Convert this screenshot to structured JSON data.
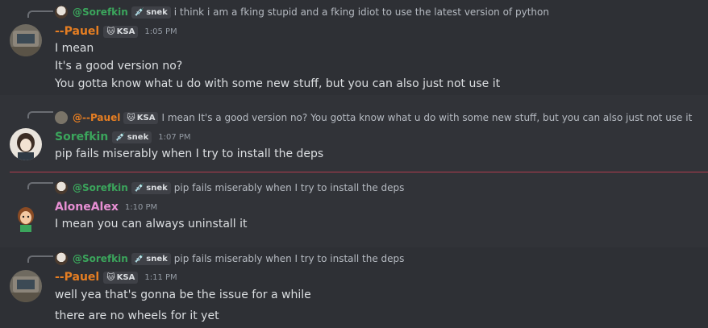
{
  "messages": [
    {
      "reply": {
        "name": "@Sorefkin",
        "tag": "snek",
        "text": "i think i am a fking stupid and a fking idiot to use the latest version of python"
      },
      "author": "--Pauel",
      "tag": "KSA",
      "time": "1:05 PM",
      "lines": [
        "I mean",
        "It's a good version no?",
        "You gotta know what u do with some new stuff, but you can also just not use it"
      ]
    },
    {
      "reply": {
        "name": "@--Pauel",
        "tag": "KSA",
        "text": "I mean It's a good version no? You gotta know what u do with some new stuff, but you can also just not use it"
      },
      "author": "Sorefkin",
      "tag": "snek",
      "time": "1:07 PM",
      "lines": [
        "pip fails miserably when I try to install the deps"
      ]
    },
    {
      "reply": {
        "name": "@Sorefkin",
        "tag": "snek",
        "text": "pip fails miserably when I try to install the deps"
      },
      "author": "AloneAlex",
      "time": "1:10 PM",
      "lines": [
        "I mean you can always uninstall it"
      ]
    },
    {
      "reply": {
        "name": "@Sorefkin",
        "tag": "snek",
        "text": "pip fails miserably when I try to install the deps"
      },
      "author": "--Pauel",
      "tag": "KSA",
      "time": "1:11 PM",
      "lines": [
        "well yea that's gonna be the issue for a while",
        "there are no wheels for it yet"
      ]
    }
  ],
  "colors": {
    "pauel": "#e67e22",
    "sorefkin": "#3ba55c",
    "alex": "#e78fd3",
    "divider": "#b13c4f"
  },
  "icons": {
    "snek_tag": "syringe-icon",
    "ksa_tag": "cat-icon"
  }
}
